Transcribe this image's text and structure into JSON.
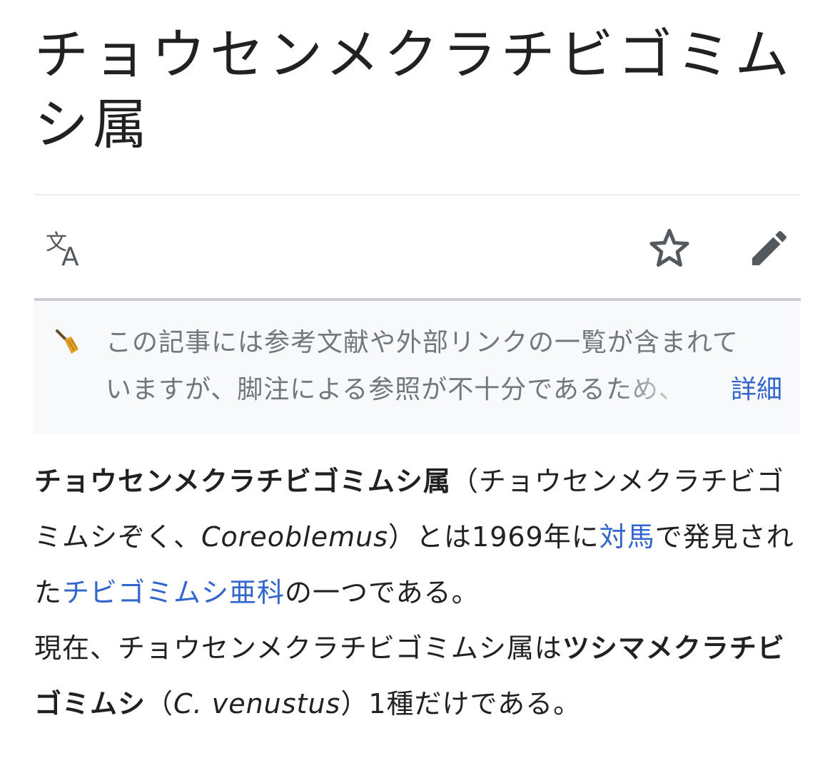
{
  "article": {
    "title": "チョウセンメクラチビゴミムシ属"
  },
  "actions": {
    "language_icon": "translate-icon",
    "star_icon": "star-outline-icon",
    "edit_icon": "pencil-icon"
  },
  "notice": {
    "icon": "broom-icon",
    "line1": "この記事には参考文献や外部リンクの一覧が含まれて",
    "line2": "いますが、脚注による参照が不十分であるため、",
    "more_label": "詳細"
  },
  "paragraph": {
    "bold_name": "チョウセンメクラチビゴミムシ属",
    "reading_open": "（チョウセンメクラチビゴミムシぞく、",
    "scientific_name": "Coreoblemus",
    "after_sci": "）とは1969年に",
    "link_tsushima": "対馬",
    "text_found": "で発見された",
    "link_subfamily": "チビゴミムシ亜科",
    "text_one": "の一つである。",
    "text_now": "現在、チョウセンメクラチビゴミムシ属は",
    "bold_species": "ツシマメクラチビゴミムシ",
    "species_open": "（",
    "species_sci": "C. venustus",
    "species_close": "）1種だけである。"
  },
  "colors": {
    "link": "#3366cc",
    "text": "#202122",
    "muted": "#72777d",
    "icon": "#54595d",
    "notice_bg": "#f8f9fa"
  }
}
